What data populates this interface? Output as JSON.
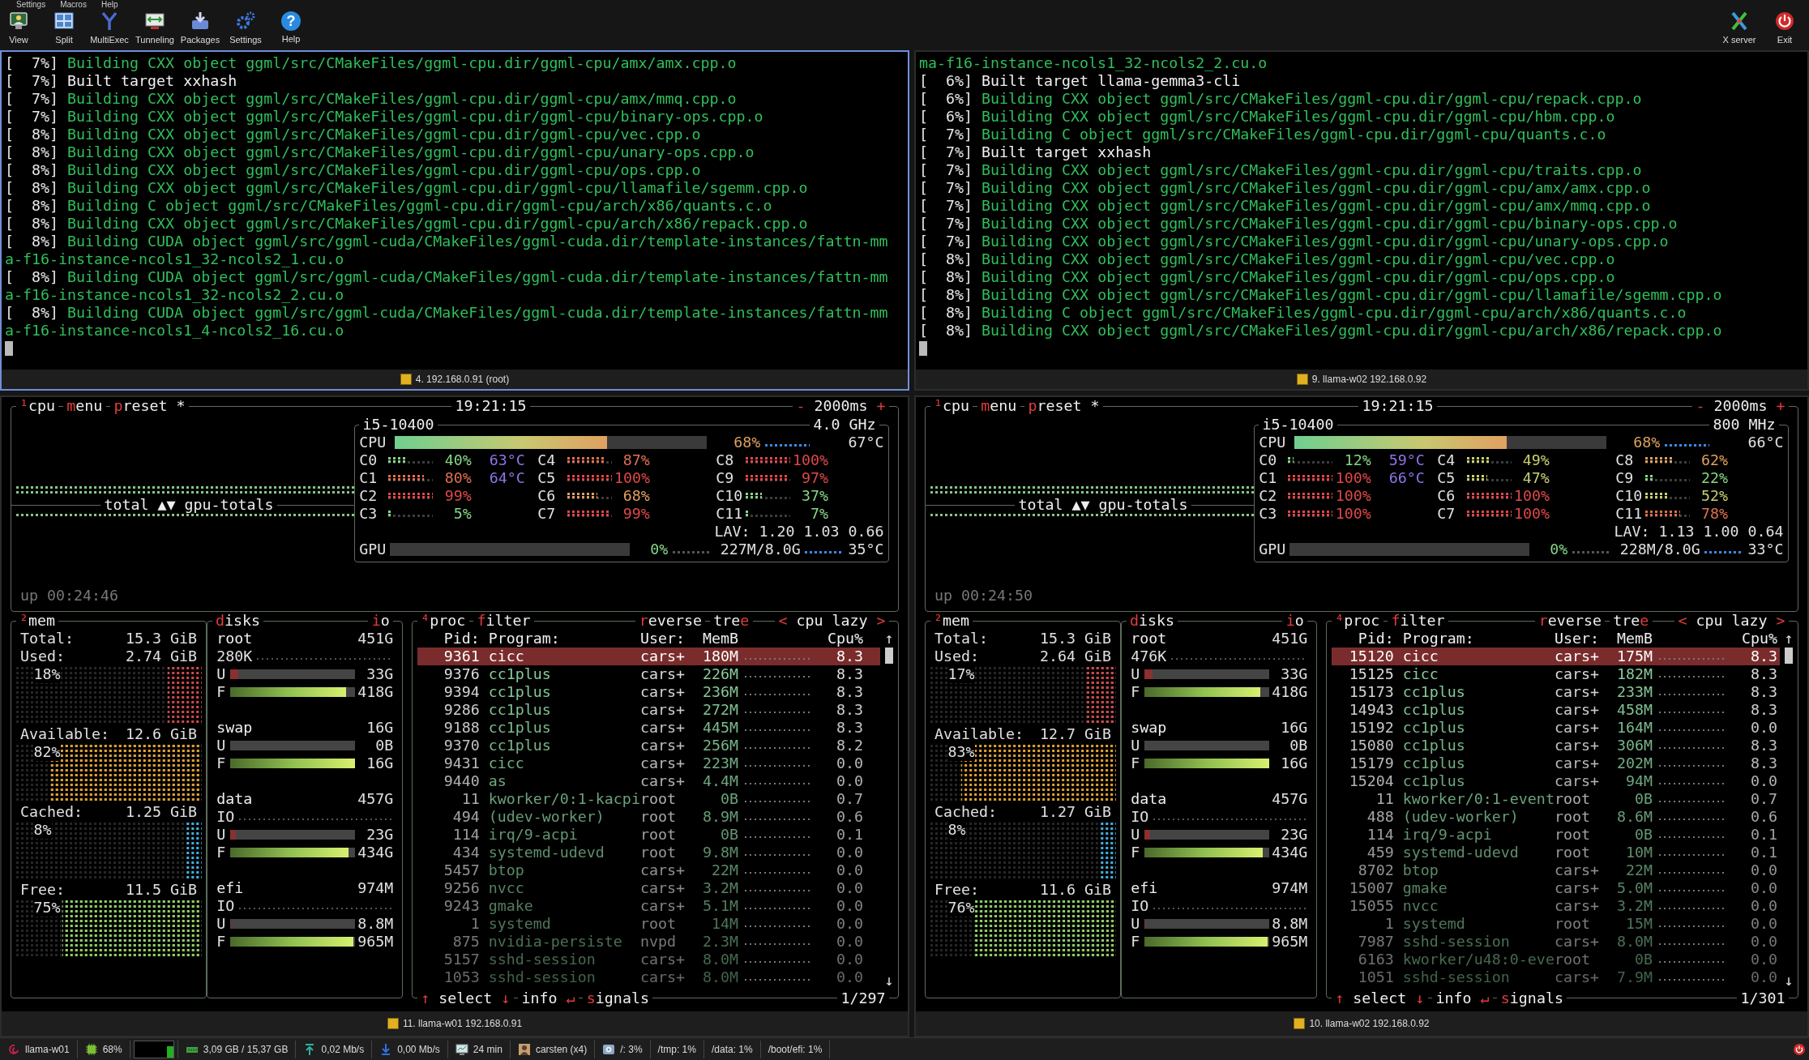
{
  "menu": [
    "Settings",
    "Macros",
    "Help"
  ],
  "toolbar": [
    {
      "label": "View",
      "kind": "view"
    },
    {
      "label": "Split",
      "kind": "split"
    },
    {
      "label": "MultiExec",
      "kind": "multiexec"
    },
    {
      "label": "Tunneling",
      "kind": "tunneling"
    },
    {
      "label": "Packages",
      "kind": "packages"
    },
    {
      "label": "Settings",
      "kind": "settings"
    },
    {
      "label": "Help",
      "kind": "help",
      "glyph": "?"
    }
  ],
  "toolbar_right": [
    {
      "label": "X server",
      "kind": "xserver"
    },
    {
      "label": "Exit",
      "kind": "exit"
    }
  ],
  "terminals": [
    {
      "caption": "4. 192.168.0.91 (root)",
      "selected": true,
      "lines": [
        {
          "progress": "[  7%]",
          "text": "Building CXX object ggml/src/CMakeFiles/ggml-cpu.dir/ggml-cpu/amx/amx.cpp.o",
          "kind": "build"
        },
        {
          "progress": "[  7%]",
          "text": "Built target xxhash",
          "kind": "target"
        },
        {
          "progress": "[  7%]",
          "text": "Building CXX object ggml/src/CMakeFiles/ggml-cpu.dir/ggml-cpu/amx/mmq.cpp.o",
          "kind": "build"
        },
        {
          "progress": "[  7%]",
          "text": "Building CXX object ggml/src/CMakeFiles/ggml-cpu.dir/ggml-cpu/binary-ops.cpp.o",
          "kind": "build"
        },
        {
          "progress": "[  8%]",
          "text": "Building CXX object ggml/src/CMakeFiles/ggml-cpu.dir/ggml-cpu/vec.cpp.o",
          "kind": "build"
        },
        {
          "progress": "[  8%]",
          "text": "Building CXX object ggml/src/CMakeFiles/ggml-cpu.dir/ggml-cpu/unary-ops.cpp.o",
          "kind": "build"
        },
        {
          "progress": "[  8%]",
          "text": "Building CXX object ggml/src/CMakeFiles/ggml-cpu.dir/ggml-cpu/ops.cpp.o",
          "kind": "build"
        },
        {
          "progress": "[  8%]",
          "text": "Building CXX object ggml/src/CMakeFiles/ggml-cpu.dir/ggml-cpu/llamafile/sgemm.cpp.o",
          "kind": "build"
        },
        {
          "progress": "[  8%]",
          "text": "Building C object ggml/src/CMakeFiles/ggml-cpu.dir/ggml-cpu/arch/x86/quants.c.o",
          "kind": "build"
        },
        {
          "progress": "[  8%]",
          "text": "Building CXX object ggml/src/CMakeFiles/ggml-cpu.dir/ggml-cpu/arch/x86/repack.cpp.o",
          "kind": "build"
        },
        {
          "progress": "[  8%]",
          "text": "Building CUDA object ggml/src/ggml-cuda/CMakeFiles/ggml-cuda.dir/template-instances/fattn-mm",
          "kind": "build"
        },
        {
          "text": "a-f16-instance-ncols1_32-ncols2_1.cu.o",
          "kind": "wrap"
        },
        {
          "progress": "[  8%]",
          "text": "Building CUDA object ggml/src/ggml-cuda/CMakeFiles/ggml-cuda.dir/template-instances/fattn-mm",
          "kind": "build"
        },
        {
          "text": "a-f16-instance-ncols1_32-ncols2_2.cu.o",
          "kind": "wrap"
        },
        {
          "progress": "[  8%]",
          "text": "Building CUDA object ggml/src/ggml-cuda/CMakeFiles/ggml-cuda.dir/template-instances/fattn-mm",
          "kind": "build"
        },
        {
          "text": "a-f16-instance-ncols1_4-ncols2_16.cu.o",
          "kind": "wrap"
        }
      ]
    },
    {
      "caption": "9. llama-w02 192.168.0.92",
      "selected": false,
      "lines": [
        {
          "text": "ma-f16-instance-ncols1_32-ncols2_2.cu.o",
          "kind": "wrap"
        },
        {
          "progress": "[  6%]",
          "text": "Built target llama-gemma3-cli",
          "kind": "target"
        },
        {
          "progress": "[  6%]",
          "text": "Building CXX object ggml/src/CMakeFiles/ggml-cpu.dir/ggml-cpu/repack.cpp.o",
          "kind": "build"
        },
        {
          "progress": "[  6%]",
          "text": "Building CXX object ggml/src/CMakeFiles/ggml-cpu.dir/ggml-cpu/hbm.cpp.o",
          "kind": "build"
        },
        {
          "progress": "[  7%]",
          "text": "Building C object ggml/src/CMakeFiles/ggml-cpu.dir/ggml-cpu/quants.c.o",
          "kind": "build"
        },
        {
          "progress": "[  7%]",
          "text": "Built target xxhash",
          "kind": "target"
        },
        {
          "progress": "[  7%]",
          "text": "Building CXX object ggml/src/CMakeFiles/ggml-cpu.dir/ggml-cpu/traits.cpp.o",
          "kind": "build"
        },
        {
          "progress": "[  7%]",
          "text": "Building CXX object ggml/src/CMakeFiles/ggml-cpu.dir/ggml-cpu/amx/amx.cpp.o",
          "kind": "build"
        },
        {
          "progress": "[  7%]",
          "text": "Building CXX object ggml/src/CMakeFiles/ggml-cpu.dir/ggml-cpu/amx/mmq.cpp.o",
          "kind": "build"
        },
        {
          "progress": "[  7%]",
          "text": "Building CXX object ggml/src/CMakeFiles/ggml-cpu.dir/ggml-cpu/binary-ops.cpp.o",
          "kind": "build"
        },
        {
          "progress": "[  7%]",
          "text": "Building CXX object ggml/src/CMakeFiles/ggml-cpu.dir/ggml-cpu/unary-ops.cpp.o",
          "kind": "build"
        },
        {
          "progress": "[  8%]",
          "text": "Building CXX object ggml/src/CMakeFiles/ggml-cpu.dir/ggml-cpu/vec.cpp.o",
          "kind": "build"
        },
        {
          "progress": "[  8%]",
          "text": "Building CXX object ggml/src/CMakeFiles/ggml-cpu.dir/ggml-cpu/ops.cpp.o",
          "kind": "build"
        },
        {
          "progress": "[  8%]",
          "text": "Building CXX object ggml/src/CMakeFiles/ggml-cpu.dir/ggml-cpu/llamafile/sgemm.cpp.o",
          "kind": "build"
        },
        {
          "progress": "[  8%]",
          "text": "Building C object ggml/src/CMakeFiles/ggml-cpu.dir/ggml-cpu/arch/x86/quants.c.o",
          "kind": "build"
        },
        {
          "progress": "[  8%]",
          "text": "Building CXX object ggml/src/CMakeFiles/ggml-cpu.dir/ggml-cpu/arch/x86/repack.cpp.o",
          "kind": "build"
        }
      ]
    }
  ],
  "monitors": [
    {
      "caption": "11. llama-w01 192.168.0.91",
      "cpu": {
        "tabs": [
          {
            "segments": [
              {
                "t": "¹",
                "hot": true
              },
              {
                "t": "cpu",
                "hot": false
              }
            ]
          },
          {
            "segments": [
              {
                "t": "m",
                "hot": true
              },
              {
                "t": "enu",
                "hot": false
              }
            ]
          },
          {
            "segments": [
              {
                "t": "p",
                "hot": true
              },
              {
                "t": "reset *",
                "hot": false
              }
            ]
          }
        ],
        "clock": "19:21:15",
        "interval": [
          {
            "t": "-",
            "hot": true
          },
          {
            "t": " 2000ms ",
            "hot": false
          },
          {
            "t": "+",
            "hot": true
          }
        ],
        "graph_label": "total ▲▼ gpu-totals",
        "uptime": "up 00:24:46",
        "model": "i5-10400",
        "freq": "4.0 GHz",
        "total": {
          "label": "CPU",
          "level": 0.68,
          "pct": "68%",
          "temp": "67°C"
        },
        "cores": [
          {
            "name": "C0",
            "pct": "40%",
            "level": 0.4,
            "temp": "63°C"
          },
          {
            "name": "C1",
            "pct": "80%",
            "level": 0.8,
            "temp": "64°C"
          },
          {
            "name": "C2",
            "pct": "99%",
            "level": 0.99
          },
          {
            "name": "C3",
            "pct": "5%",
            "level": 0.05
          },
          {
            "name": "C4",
            "pct": "87%",
            "level": 0.87
          },
          {
            "name": "C5",
            "pct": "100%",
            "level": 1
          },
          {
            "name": "C6",
            "pct": "68%",
            "level": 0.68
          },
          {
            "name": "C7",
            "pct": "99%",
            "level": 0.99
          },
          {
            "name": "C8",
            "pct": "100%",
            "level": 1
          },
          {
            "name": "C9",
            "pct": "97%",
            "level": 0.97
          },
          {
            "name": "C10",
            "pct": "37%",
            "level": 0.37
          },
          {
            "name": "C11",
            "pct": "7%",
            "level": 0.07
          }
        ],
        "lav": "LAV: 1.20 1.03 0.66",
        "gpu": {
          "label": "GPU",
          "level": 0,
          "pct": "0%",
          "mem": "227M/8.0G",
          "temp": "35°C"
        }
      },
      "mem": {
        "title": [
          {
            "t": "²",
            "hot": true
          },
          {
            "t": "mem",
            "hot": false
          }
        ],
        "items": [
          {
            "label": "Total:",
            "value": "15.3 GiB"
          },
          {
            "label": "Used:",
            "value": "2.74 GiB",
            "pct": "18%",
            "level": 0.18,
            "color": "#d04848"
          },
          {
            "label": "Available:",
            "value": "12.6 GiB",
            "pct": "82%",
            "level": 0.82,
            "color": "#e0a030"
          },
          {
            "label": "Cached:",
            "value": "1.25 GiB",
            "pct": "8%",
            "level": 0.08,
            "color": "#40b0e0"
          },
          {
            "label": "Free:",
            "value": "11.5 GiB",
            "pct": "75%",
            "level": 0.75,
            "color": "#90d060"
          }
        ]
      },
      "disks": {
        "title": [
          {
            "t": "d",
            "hot": true
          },
          {
            "t": "isks",
            "hot": false
          }
        ],
        "io_title": [
          {
            "t": "i",
            "hot": true
          },
          {
            "t": "o",
            "hot": false
          }
        ],
        "items": [
          {
            "name": "root",
            "size": "451G",
            "io": "280K",
            "used": {
              "label": "U",
              "value": "33G",
              "level": 0.07
            },
            "free": {
              "label": "F",
              "value": "418G",
              "level": 0.93
            }
          },
          {
            "name": "swap",
            "size": "16G",
            "used": {
              "label": "U",
              "value": "0B",
              "level": 0
            },
            "free": {
              "label": "F",
              "value": "16G",
              "level": 1
            }
          },
          {
            "name": "data",
            "size": "457G",
            "io": "IO",
            "used": {
              "label": "U",
              "value": "23G",
              "level": 0.05
            },
            "free": {
              "label": "F",
              "value": "434G",
              "level": 0.95
            }
          },
          {
            "name": "efi",
            "size": "974M",
            "io": "IO",
            "used": {
              "label": "U",
              "value": "8.8M",
              "level": 0.01
            },
            "free": {
              "label": "F",
              "value": "965M",
              "level": 0.99
            }
          }
        ]
      },
      "proc": {
        "tabs": [
          {
            "segments": [
              {
                "t": "⁴",
                "hot": true
              },
              {
                "t": "proc",
                "hot": false
              }
            ]
          },
          {
            "segments": [
              {
                "t": "f",
                "hot": true
              },
              {
                "t": "ilter",
                "hot": false
              }
            ]
          },
          {
            "segments": [
              {
                "t": "r",
                "hot": true
              },
              {
                "t": "everse",
                "hot": false
              }
            ]
          },
          {
            "segments": [
              {
                "t": "tre",
                "hot": false
              },
              {
                "t": "e",
                "hot": true
              }
            ]
          },
          {
            "segments": [
              {
                "t": "<",
                "hot": true
              },
              {
                "t": " cpu lazy ",
                "hot": false
              },
              {
                "t": ">",
                "hot": true
              }
            ]
          }
        ],
        "columns": [
          "Pid:",
          "Program:",
          "User:",
          "MemB",
          "Cpu%"
        ],
        "scroll_up": "↑",
        "scroll_down": "↓",
        "rows": [
          {
            "pid": "9361",
            "program": "cicc",
            "user": "cars+",
            "mem": "180M",
            "cpu": "8.3",
            "selected": true
          },
          {
            "pid": "9376",
            "program": "cc1plus",
            "user": "cars+",
            "mem": "226M",
            "cpu": "8.3",
            "selected": false
          },
          {
            "pid": "9394",
            "program": "cc1plus",
            "user": "cars+",
            "mem": "236M",
            "cpu": "8.3",
            "selected": false
          },
          {
            "pid": "9286",
            "program": "cc1plus",
            "user": "cars+",
            "mem": "272M",
            "cpu": "8.3",
            "selected": false
          },
          {
            "pid": "9188",
            "program": "cc1plus",
            "user": "cars+",
            "mem": "445M",
            "cpu": "8.3",
            "selected": false
          },
          {
            "pid": "9370",
            "program": "cc1plus",
            "user": "cars+",
            "mem": "256M",
            "cpu": "8.2",
            "selected": false
          },
          {
            "pid": "9431",
            "program": "cicc",
            "user": "cars+",
            "mem": "223M",
            "cpu": "0.0",
            "selected": false
          },
          {
            "pid": "9440",
            "program": "as",
            "user": "cars+",
            "mem": "4.4M",
            "cpu": "0.0",
            "selected": false
          },
          {
            "pid": "11",
            "program": "kworker/0:1-kacpi",
            "user": "root",
            "mem": "0B",
            "cpu": "0.7",
            "selected": false
          },
          {
            "pid": "494",
            "program": "(udev-worker)",
            "user": "root",
            "mem": "8.9M",
            "cpu": "0.6",
            "selected": false
          },
          {
            "pid": "114",
            "program": "irq/9-acpi",
            "user": "root",
            "mem": "0B",
            "cpu": "0.1",
            "selected": false
          },
          {
            "pid": "434",
            "program": "systemd-udevd",
            "user": "root",
            "mem": "9.8M",
            "cpu": "0.0",
            "selected": false
          },
          {
            "pid": "5457",
            "program": "btop",
            "user": "cars+",
            "mem": "22M",
            "cpu": "0.0",
            "selected": false
          },
          {
            "pid": "9256",
            "program": "nvcc",
            "user": "cars+",
            "mem": "3.2M",
            "cpu": "0.0",
            "selected": false
          },
          {
            "pid": "9243",
            "program": "gmake",
            "user": "cars+",
            "mem": "5.1M",
            "cpu": "0.0",
            "selected": false
          },
          {
            "pid": "1",
            "program": "systemd",
            "user": "root",
            "mem": "14M",
            "cpu": "0.0",
            "selected": false
          },
          {
            "pid": "875",
            "program": "nvidia-persiste",
            "user": "nvpd",
            "mem": "2.3M",
            "cpu": "0.0",
            "selected": false
          },
          {
            "pid": "5157",
            "program": "sshd-session",
            "user": "cars+",
            "mem": "8.0M",
            "cpu": "0.0",
            "selected": false
          },
          {
            "pid": "1053",
            "program": "sshd-session",
            "user": "cars+",
            "mem": "8.0M",
            "cpu": "0.0",
            "selected": false
          }
        ],
        "footer": [
          {
            "segments": [
              {
                "t": "↑",
                "hot": true
              },
              {
                "t": " select ",
                "hot": false
              },
              {
                "t": "↓",
                "hot": true
              }
            ]
          },
          {
            "segments": [
              {
                "t": "info ",
                "hot": false
              },
              {
                "t": "↵",
                "hot": true
              }
            ]
          },
          {
            "segments": [
              {
                "t": "s",
                "hot": true
              },
              {
                "t": "ignals",
                "hot": false
              }
            ]
          }
        ],
        "count": "1/297"
      }
    },
    {
      "caption": "10. llama-w02 192.168.0.92",
      "cpu": {
        "tabs": [
          {
            "segments": [
              {
                "t": "¹",
                "hot": true
              },
              {
                "t": "cpu",
                "hot": false
              }
            ]
          },
          {
            "segments": [
              {
                "t": "m",
                "hot": true
              },
              {
                "t": "enu",
                "hot": false
              }
            ]
          },
          {
            "segments": [
              {
                "t": "p",
                "hot": true
              },
              {
                "t": "reset *",
                "hot": false
              }
            ]
          }
        ],
        "clock": "19:21:15",
        "interval": [
          {
            "t": "-",
            "hot": true
          },
          {
            "t": " 2000ms ",
            "hot": false
          },
          {
            "t": "+",
            "hot": true
          }
        ],
        "graph_label": "total ▲▼ gpu-totals",
        "uptime": "up 00:24:50",
        "model": "i5-10400",
        "freq": "800 MHz",
        "total": {
          "label": "CPU",
          "level": 0.68,
          "pct": "68%",
          "temp": "66°C"
        },
        "cores": [
          {
            "name": "C0",
            "pct": "12%",
            "level": 0.12,
            "temp": "59°C"
          },
          {
            "name": "C1",
            "pct": "100%",
            "level": 1,
            "temp": "66°C"
          },
          {
            "name": "C2",
            "pct": "100%",
            "level": 1
          },
          {
            "name": "C3",
            "pct": "100%",
            "level": 1
          },
          {
            "name": "C4",
            "pct": "49%",
            "level": 0.49
          },
          {
            "name": "C5",
            "pct": "47%",
            "level": 0.47
          },
          {
            "name": "C6",
            "pct": "100%",
            "level": 1
          },
          {
            "name": "C7",
            "pct": "100%",
            "level": 1
          },
          {
            "name": "C8",
            "pct": "62%",
            "level": 0.62
          },
          {
            "name": "C9",
            "pct": "22%",
            "level": 0.22
          },
          {
            "name": "C10",
            "pct": "52%",
            "level": 0.52
          },
          {
            "name": "C11",
            "pct": "78%",
            "level": 0.78
          }
        ],
        "lav": "LAV: 1.13 1.00 0.64",
        "gpu": {
          "label": "GPU",
          "level": 0,
          "pct": "0%",
          "mem": "228M/8.0G",
          "temp": "33°C"
        }
      },
      "mem": {
        "title": [
          {
            "t": "²",
            "hot": true
          },
          {
            "t": "mem",
            "hot": false
          }
        ],
        "items": [
          {
            "label": "Total:",
            "value": "15.3 GiB"
          },
          {
            "label": "Used:",
            "value": "2.64 GiB",
            "pct": "17%",
            "level": 0.17,
            "color": "#d04848"
          },
          {
            "label": "Available:",
            "value": "12.7 GiB",
            "pct": "83%",
            "level": 0.83,
            "color": "#e0a030"
          },
          {
            "label": "Cached:",
            "value": "1.27 GiB",
            "pct": "8%",
            "level": 0.08,
            "color": "#40b0e0"
          },
          {
            "label": "Free:",
            "value": "11.6 GiB",
            "pct": "76%",
            "level": 0.76,
            "color": "#90d060"
          }
        ]
      },
      "disks": {
        "title": [
          {
            "t": "d",
            "hot": true
          },
          {
            "t": "isks",
            "hot": false
          }
        ],
        "io_title": [
          {
            "t": "i",
            "hot": true
          },
          {
            "t": "o",
            "hot": false
          }
        ],
        "items": [
          {
            "name": "root",
            "size": "451G",
            "io": "476K",
            "used": {
              "label": "U",
              "value": "33G",
              "level": 0.07
            },
            "free": {
              "label": "F",
              "value": "418G",
              "level": 0.93
            }
          },
          {
            "name": "swap",
            "size": "16G",
            "used": {
              "label": "U",
              "value": "0B",
              "level": 0
            },
            "free": {
              "label": "F",
              "value": "16G",
              "level": 1
            }
          },
          {
            "name": "data",
            "size": "457G",
            "io": "IO",
            "used": {
              "label": "U",
              "value": "23G",
              "level": 0.05
            },
            "free": {
              "label": "F",
              "value": "434G",
              "level": 0.95
            }
          },
          {
            "name": "efi",
            "size": "974M",
            "io": "IO",
            "used": {
              "label": "U",
              "value": "8.8M",
              "level": 0.01
            },
            "free": {
              "label": "F",
              "value": "965M",
              "level": 0.99
            }
          }
        ]
      },
      "proc": {
        "tabs": [
          {
            "segments": [
              {
                "t": "⁴",
                "hot": true
              },
              {
                "t": "proc",
                "hot": false
              }
            ]
          },
          {
            "segments": [
              {
                "t": "f",
                "hot": true
              },
              {
                "t": "ilter",
                "hot": false
              }
            ]
          },
          {
            "segments": [
              {
                "t": "r",
                "hot": true
              },
              {
                "t": "everse",
                "hot": false
              }
            ]
          },
          {
            "segments": [
              {
                "t": "tre",
                "hot": false
              },
              {
                "t": "e",
                "hot": true
              }
            ]
          },
          {
            "segments": [
              {
                "t": "<",
                "hot": true
              },
              {
                "t": " cpu lazy ",
                "hot": false
              },
              {
                "t": ">",
                "hot": true
              }
            ]
          }
        ],
        "columns": [
          "Pid:",
          "Program:",
          "User:",
          "MemB",
          "Cpu%"
        ],
        "scroll_up": "↑",
        "scroll_down": "↓",
        "rows": [
          {
            "pid": "15120",
            "program": "cicc",
            "user": "cars+",
            "mem": "175M",
            "cpu": "8.3",
            "selected": true
          },
          {
            "pid": "15125",
            "program": "cicc",
            "user": "cars+",
            "mem": "182M",
            "cpu": "8.3",
            "selected": false
          },
          {
            "pid": "15173",
            "program": "cc1plus",
            "user": "cars+",
            "mem": "233M",
            "cpu": "8.3",
            "selected": false
          },
          {
            "pid": "14943",
            "program": "cc1plus",
            "user": "cars+",
            "mem": "458M",
            "cpu": "8.3",
            "selected": false
          },
          {
            "pid": "15192",
            "program": "cc1plus",
            "user": "cars+",
            "mem": "164M",
            "cpu": "0.0",
            "selected": false
          },
          {
            "pid": "15080",
            "program": "cc1plus",
            "user": "cars+",
            "mem": "306M",
            "cpu": "8.3",
            "selected": false
          },
          {
            "pid": "15179",
            "program": "cc1plus",
            "user": "cars+",
            "mem": "202M",
            "cpu": "8.3",
            "selected": false
          },
          {
            "pid": "15204",
            "program": "cc1plus",
            "user": "cars+",
            "mem": "94M",
            "cpu": "0.0",
            "selected": false
          },
          {
            "pid": "11",
            "program": "kworker/0:1-event",
            "user": "root",
            "mem": "0B",
            "cpu": "0.7",
            "selected": false
          },
          {
            "pid": "488",
            "program": "(udev-worker)",
            "user": "root",
            "mem": "8.6M",
            "cpu": "0.6",
            "selected": false
          },
          {
            "pid": "114",
            "program": "irq/9-acpi",
            "user": "root",
            "mem": "0B",
            "cpu": "0.1",
            "selected": false
          },
          {
            "pid": "459",
            "program": "systemd-udevd",
            "user": "root",
            "mem": "10M",
            "cpu": "0.1",
            "selected": false
          },
          {
            "pid": "8702",
            "program": "btop",
            "user": "cars+",
            "mem": "22M",
            "cpu": "0.0",
            "selected": false
          },
          {
            "pid": "15007",
            "program": "gmake",
            "user": "cars+",
            "mem": "5.0M",
            "cpu": "0.0",
            "selected": false
          },
          {
            "pid": "15055",
            "program": "nvcc",
            "user": "cars+",
            "mem": "3.2M",
            "cpu": "0.0",
            "selected": false
          },
          {
            "pid": "1",
            "program": "systemd",
            "user": "root",
            "mem": "15M",
            "cpu": "0.0",
            "selected": false
          },
          {
            "pid": "7987",
            "program": "sshd-session",
            "user": "cars+",
            "mem": "8.0M",
            "cpu": "0.0",
            "selected": false
          },
          {
            "pid": "6163",
            "program": "kworker/u48:0-eve",
            "user": "root",
            "mem": "0B",
            "cpu": "0.0",
            "selected": false
          },
          {
            "pid": "1051",
            "program": "sshd-session",
            "user": "cars+",
            "mem": "7.9M",
            "cpu": "0.0",
            "selected": false
          }
        ],
        "footer": [
          {
            "segments": [
              {
                "t": "↑",
                "hot": true
              },
              {
                "t": " select ",
                "hot": false
              },
              {
                "t": "↓",
                "hot": true
              }
            ]
          },
          {
            "segments": [
              {
                "t": "info ",
                "hot": false
              },
              {
                "t": "↵",
                "hot": true
              }
            ]
          },
          {
            "segments": [
              {
                "t": "s",
                "hot": true
              },
              {
                "t": "ignals",
                "hot": false
              }
            ]
          }
        ],
        "count": "1/301"
      }
    }
  ],
  "status_bar": [
    {
      "kind": "host",
      "text": "llama-w01"
    },
    {
      "kind": "cpu",
      "text": "68%"
    },
    {
      "kind": "cpu-graph"
    },
    {
      "kind": "ram",
      "text": "3,09 GB / 15,37 GB"
    },
    {
      "kind": "upload",
      "text": "0,02 Mb/s"
    },
    {
      "kind": "download",
      "text": "0,00 Mb/s"
    },
    {
      "kind": "uptime",
      "text": "24 min"
    },
    {
      "kind": "user",
      "text": "carsten (x4)"
    },
    {
      "kind": "disk",
      "text": "/: 3%"
    },
    {
      "kind": "plain",
      "text": "/tmp: 1%"
    },
    {
      "kind": "plain",
      "text": "/data: 1%"
    },
    {
      "kind": "plain",
      "text": "/boot/efi: 1%"
    }
  ]
}
